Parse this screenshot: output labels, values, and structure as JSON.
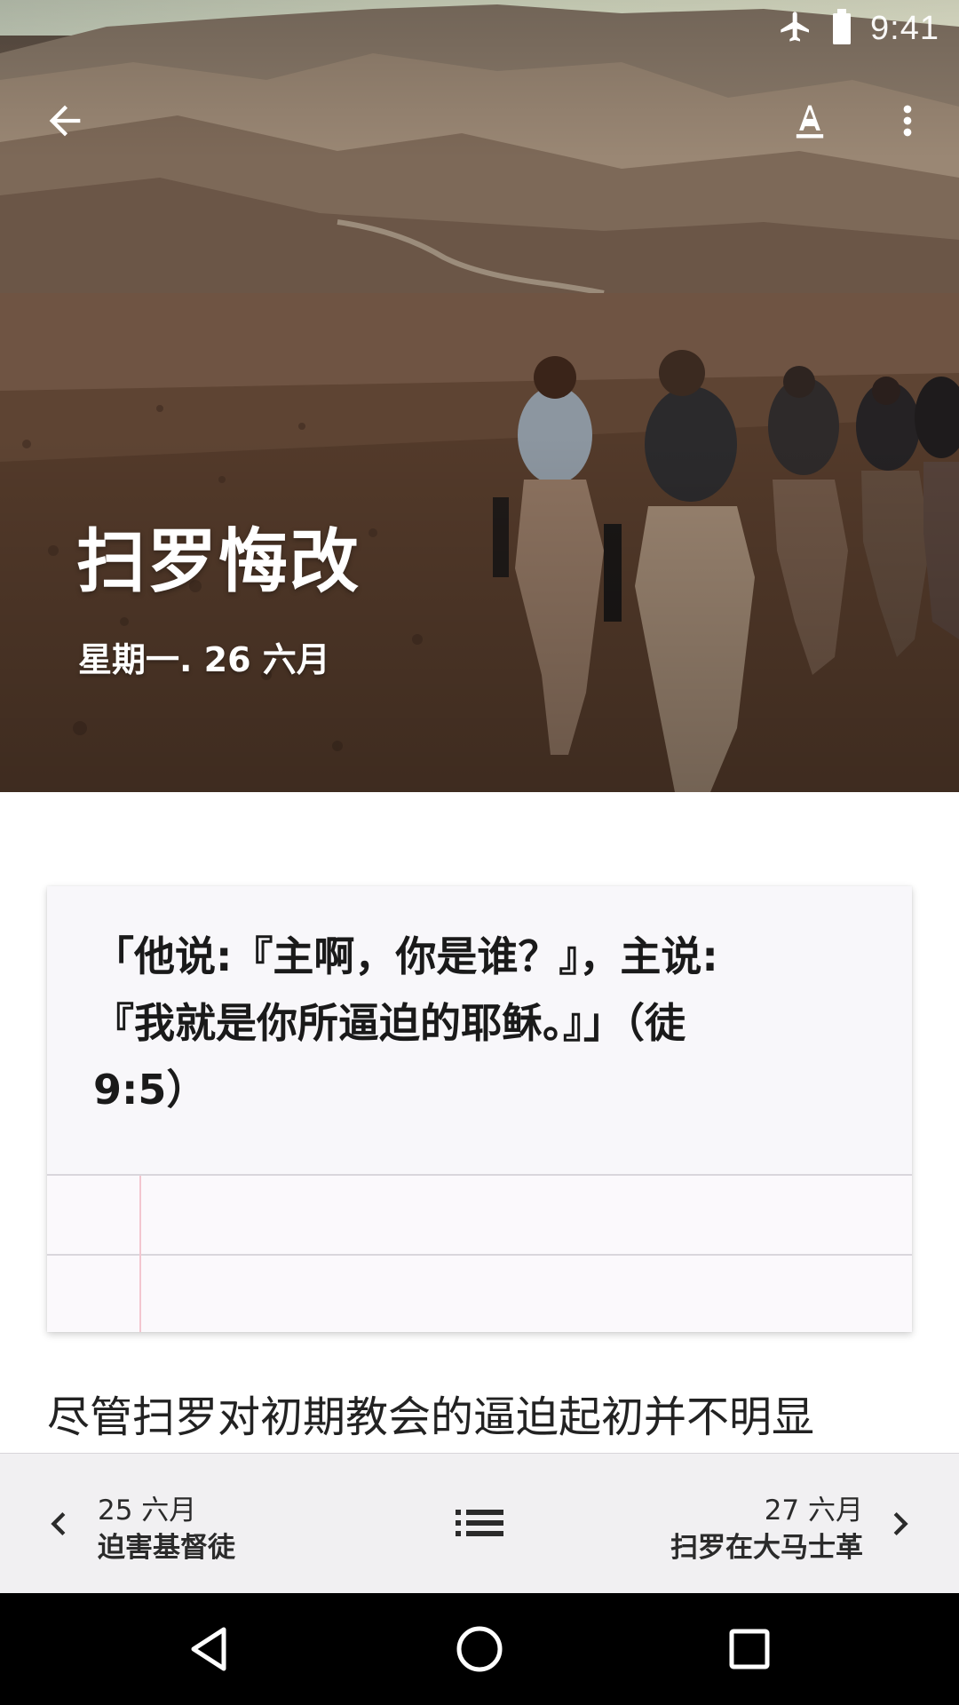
{
  "status_bar": {
    "time": "9:41",
    "icons": [
      "airplane-mode-icon",
      "battery-icon"
    ]
  },
  "toolbar": {
    "back_icon": "arrow-back-icon",
    "text_format_icon": "text-format-icon",
    "more_icon": "more-vert-icon"
  },
  "hero": {
    "title": "扫罗悔改",
    "date": "星期一. 26 六月"
  },
  "quote": {
    "lines": [
      "「他说:『主啊，你是谁？』，主说:",
      "『我就是你所逼迫的耶稣。』」（徒",
      "9:5）"
    ]
  },
  "body": {
    "first_line": "尽管扫罗对初期教会的逼迫起初并不明显"
  },
  "bottom_nav": {
    "prev": {
      "date": "25 六月",
      "title": "迫害基督徒"
    },
    "next": {
      "date": "27 六月",
      "title": "扫罗在大马士革"
    },
    "list_icon": "list-icon"
  },
  "system_nav": {
    "icons": [
      "back-triangle-icon",
      "home-circle-icon",
      "recents-square-icon"
    ]
  }
}
